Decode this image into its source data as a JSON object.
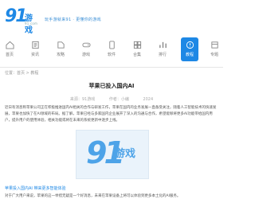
{
  "header": {
    "logo_number": "91",
    "logo_name": "游戏",
    "logo_sub": "91.com",
    "slogan": "玩手游就来91 · 更懂你的游戏"
  },
  "nav": {
    "items": [
      {
        "label": "首页",
        "icon": "home-icon"
      },
      {
        "label": "资讯",
        "icon": "news-icon"
      },
      {
        "label": "攻略",
        "icon": "guide-icon"
      },
      {
        "label": "游戏",
        "icon": "gamepad-icon"
      },
      {
        "label": "软件",
        "icon": "app-icon"
      },
      {
        "label": "合集",
        "icon": "collection-icon"
      },
      {
        "label": "排行",
        "icon": "rank-icon"
      },
      {
        "label": "教程",
        "icon": "tutorial-icon",
        "active": true
      },
      {
        "label": "专题",
        "icon": "topic-icon"
      }
    ]
  },
  "breadcrumb": "位置：首页 > 教程",
  "article": {
    "title": "苹果已投入国内AI",
    "meta_source": "来源：91游戏",
    "meta_author": "作者：小编",
    "meta_time": "2024",
    "paragraph": "近日有消息称苹果公司正在积极推进国内AI相关的合作与研发工作，苹果在国内的业务发展一直备受关注，随着人工智能技术的快速发展，苹果也加快了在AI领域的布局。据了解，苹果已经与多家国内企业展开了深入的沟通与合作，希望能够将更多AI功能带给国内用户，提升用户的使用体验，相关功能或将在未来的系统更新中逐步上线。",
    "subheading": "苹果投入国内AI 带来更多智能体验",
    "paragraph2": "对于广大用户来说，苹果的这一举措无疑是一个好消息，未来在苹果设备上将可以体验到更多本土化的AI服务。"
  },
  "colors": {
    "accent": "#1e88e5"
  }
}
